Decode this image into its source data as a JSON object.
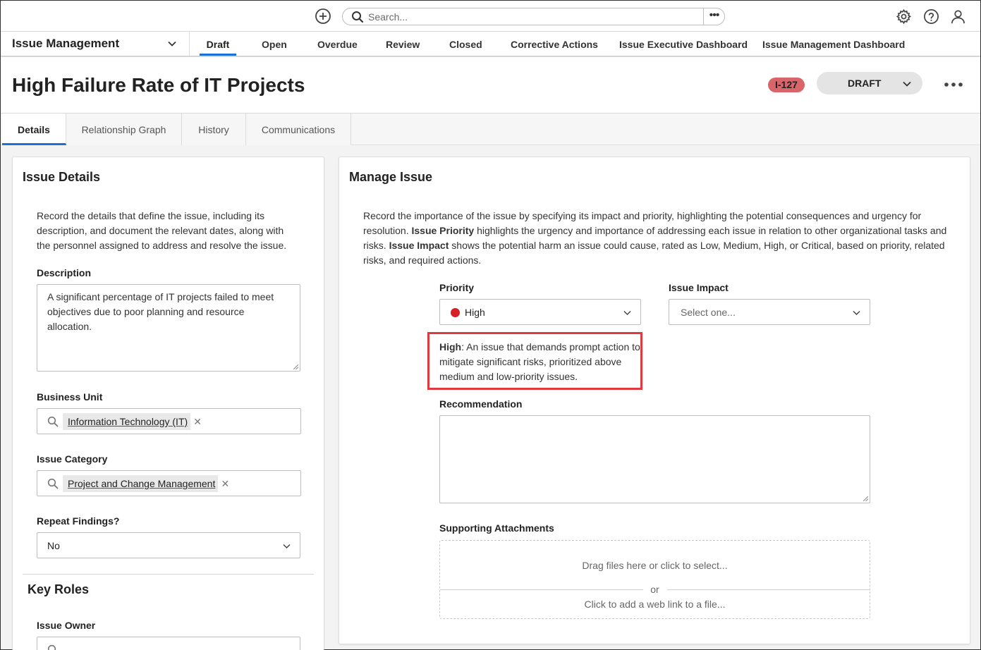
{
  "topbar": {
    "search_placeholder": "Search..."
  },
  "nav": {
    "app_name": "Issue Management",
    "tabs": [
      "Draft",
      "Open",
      "Overdue",
      "Review",
      "Closed",
      "Corrective Actions",
      "Issue Executive Dashboard",
      "Issue Management Dashboard"
    ]
  },
  "header": {
    "title": "High Failure Rate of IT Projects",
    "id_badge": "I-127",
    "state": "DRAFT"
  },
  "detail_tabs": [
    "Details",
    "Relationship Graph",
    "History",
    "Communications"
  ],
  "issue_details": {
    "title": "Issue Details",
    "description_text": "Record the details that define the issue, including its description, and document the relevant dates, along with the personnel assigned to address and resolve the issue.",
    "description_label": "Description",
    "description_value": "A significant percentage of IT projects failed to meet objectives due to poor planning and resource allocation.",
    "business_unit_label": "Business Unit",
    "business_unit_value": "Information Technology (IT)",
    "issue_category_label": "Issue Category",
    "issue_category_value": "Project and Change Management",
    "repeat_findings_label": "Repeat Findings?",
    "repeat_findings_value": "No",
    "key_roles_title": "Key Roles",
    "issue_owner_label": "Issue Owner"
  },
  "manage_issue": {
    "title": "Manage Issue",
    "intro_1": "Record the importance of the issue by specifying its impact and priority, highlighting the potential consequences and urgency for resolution. ",
    "intro_bold_1": "Issue Priority",
    "intro_2": " highlights the urgency and importance of addressing each issue in relation to other organizational tasks and risks. ",
    "intro_bold_2": "Issue Impact",
    "intro_3": " shows the potential harm an issue could cause, rated as Low, Medium, High, or Critical, based on priority, related risks, and required actions.",
    "priority_label": "Priority",
    "priority_value": "High",
    "priority_color": "#d71f27",
    "impact_label": "Issue Impact",
    "impact_placeholder": "Select one...",
    "help_bold": "High",
    "help_text": ": An issue that demands prompt action to mitigate significant risks, prioritized above medium and low-priority issues.",
    "recommendation_label": "Recommendation",
    "attachments_label": "Supporting Attachments",
    "drop_text": "Drag files here or click to select...",
    "or_text": "or",
    "link_text": "Click to add a web link to a file..."
  },
  "colors": {
    "accent": "#1b6fd8",
    "badge": "#d9646a",
    "highlight": "#e0393e"
  }
}
